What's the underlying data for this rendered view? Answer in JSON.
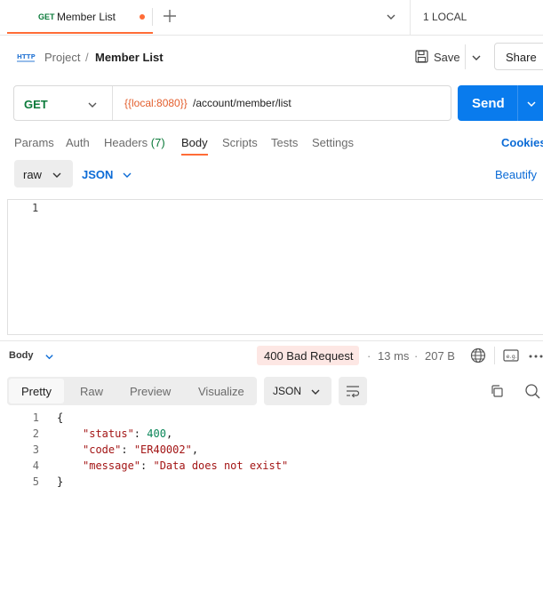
{
  "tabs": {
    "active": {
      "method": "GET",
      "name": "Member List"
    },
    "environment": "1 LOCAL"
  },
  "breadcrumb": {
    "icon": "http-icon",
    "project": "Project",
    "separator": "/",
    "current": "Member List"
  },
  "actions": {
    "save_label": "Save",
    "share_label": "Share"
  },
  "request": {
    "method": "GET",
    "url_variable": "{{local:8080}}",
    "url_path": "/account/member/list",
    "send_label": "Send"
  },
  "request_tabs": {
    "params": "Params",
    "auth": "Auth",
    "headers": "Headers",
    "headers_count": "(7)",
    "body": "Body",
    "scripts": "Scripts",
    "tests": "Tests",
    "settings": "Settings",
    "cookies": "Cookies"
  },
  "body_options": {
    "mode": "raw",
    "language": "JSON",
    "beautify": "Beautify"
  },
  "editor": {
    "line_numbers": [
      "1"
    ]
  },
  "response": {
    "section_label": "Body",
    "status": "400 Bad Request",
    "separator": "·",
    "time": "13 ms",
    "size": "207 B",
    "view_tabs": {
      "pretty": "Pretty",
      "raw": "Raw",
      "preview": "Preview",
      "visualize": "Visualize"
    },
    "format": "JSON",
    "line_numbers": [
      "1",
      "2",
      "3",
      "4",
      "5"
    ],
    "code": {
      "open": "{",
      "close": "}",
      "status_key": "\"status\"",
      "status_value": "400",
      "code_key": "\"code\"",
      "code_value": "\"ER40002\"",
      "message_key": "\"message\"",
      "message_value": "\"Data does not exist\"",
      "colon": ": ",
      "comma": ","
    }
  },
  "colors": {
    "accent": "#ff6c37",
    "send": "#097bed",
    "link": "#0b6bd6",
    "method_get": "#0b7a3a",
    "error_badge": "#fde7e4"
  }
}
